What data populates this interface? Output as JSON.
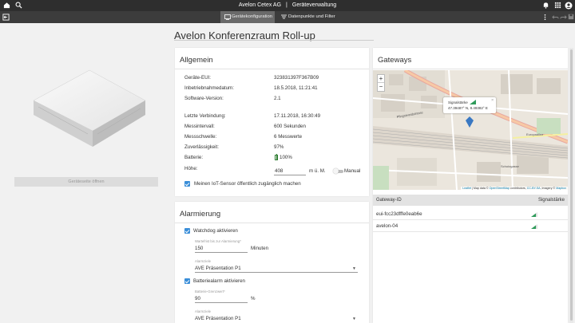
{
  "header": {
    "company": "Avelon Cetex AG",
    "separator": "|",
    "section": "Geräteverwaltung"
  },
  "tabs": [
    {
      "label": "Gerätekonfiguration",
      "active": true
    },
    {
      "label": "Datenpunkte und Filter",
      "active": false
    }
  ],
  "left": {
    "open_button": "Geräteseite öffnen"
  },
  "page_title": "Avelon Konferenzraum Roll-up",
  "general": {
    "title": "Allgemein",
    "labels": {
      "eui": "Geräte-EUI:",
      "commissioning": "Inbetriebnahmedatum:",
      "software": "Software-Version:",
      "last_conn": "Letzte Verbindung:",
      "interval": "Messintervall:",
      "threshold": "Messschwelle:",
      "reliability": "Zuverlässigkeit:",
      "battery": "Batterie:",
      "height": "Höhe:"
    },
    "values": {
      "eui": "323831397F367B09",
      "commissioning": "18.5.2018, 11:21:41",
      "software": "2.1",
      "last_conn": "17.11.2018, 16:30:49",
      "interval": "600",
      "interval_unit": "Sekunden",
      "threshold": "6",
      "threshold_unit": "Messwerte",
      "reliability": "97%",
      "battery": "100%",
      "battery_level": 1.0,
      "height": "408",
      "height_unit": "m ü. M.",
      "manual": "Manual"
    },
    "public_checkbox": "Meinen IoT-Sensor öffentlich zugänglich machen"
  },
  "alarm": {
    "title": "Alarmierung",
    "watchdog_label": "Watchdog aktivieren",
    "wait_label": "Wartefrist bis zur Alarmierung",
    "wait_value": "150",
    "wait_unit": "Minuten",
    "alarmgroup_label": "Alarmziele",
    "alarmgroup_value": "AVE Präsentation P1",
    "battery_alarm_label": "Batteriealarm aktivieren",
    "battery_threshold_label": "Batterie-Grenzwert",
    "battery_threshold_value": "90",
    "battery_threshold_unit": "%",
    "alarmgroup2_label": "Alarmziele",
    "alarmgroup2_value": "AVE Präsentation P1",
    "required_mark": "*"
  },
  "gateways": {
    "title": "Gateways",
    "popup_label": "Signalstärke",
    "popup_close": "×",
    "popup_coords": "47.39487° N,  8.49382° E",
    "zoom_in": "+",
    "zoom_out": "−",
    "attribution": {
      "leaflet": "Leaflet",
      "map_data": "| Map data ©",
      "osm": "OpenStreetMap",
      "contributors": "contributors,",
      "license": "CC-BY-SA",
      "imagery": ", Imagery ©",
      "mapbox": "Mapbox"
    },
    "street_labels": [
      "Pfingstweidstrasse",
      "Europaallee",
      "Schutzgasse"
    ],
    "col_id": "Gateway-ID",
    "col_signal": "Signalstärke",
    "rows": [
      {
        "id": "eui-fcc23dfffe0eab6e",
        "signal": 0.75
      },
      {
        "id": "avelon-04",
        "signal": 0.75
      }
    ]
  },
  "colors": {
    "topbar": "#2e2e2e",
    "subbar": "#3c3c3c",
    "accent": "#3a8ed8",
    "signal": "#2e9b5a"
  },
  "icons": [
    "home-icon",
    "search-icon",
    "bell-icon",
    "grid-icon",
    "account-icon",
    "exit-icon",
    "config-icon",
    "filter-icon",
    "more-vert-icon",
    "undo-icon",
    "redo-icon",
    "save-icon"
  ]
}
